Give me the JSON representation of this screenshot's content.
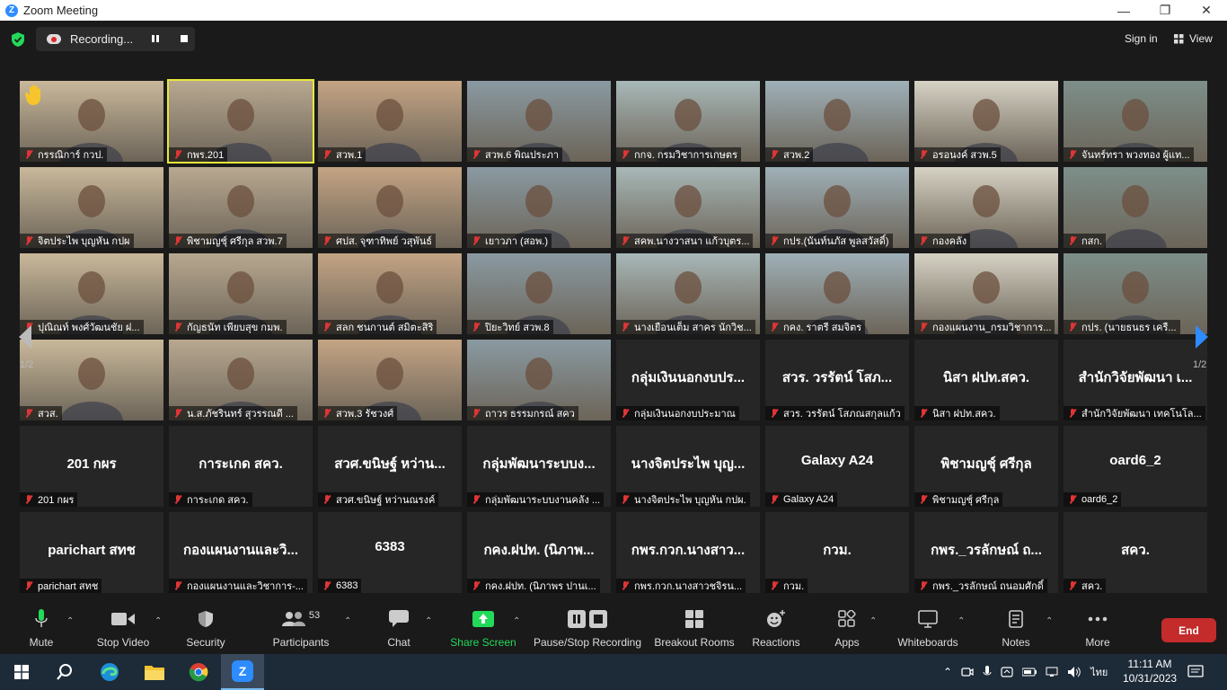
{
  "window": {
    "title": "Zoom Meeting",
    "logo": "Z"
  },
  "topbar": {
    "recording_label": "Recording...",
    "sign_in": "Sign in",
    "view": "View"
  },
  "grid": {
    "page_left": "1/2",
    "page_right": "1/2",
    "tiles": [
      {
        "label": "กรรณิการ์ กวป.",
        "bigname": "",
        "video": true,
        "hand": true
      },
      {
        "label": "กพร.201",
        "bigname": "",
        "video": true,
        "active": true
      },
      {
        "label": "สวพ.1",
        "bigname": "",
        "video": true
      },
      {
        "label": "สวพ.6 พิณประภา",
        "bigname": "",
        "video": true
      },
      {
        "label": "กกจ. กรมวิชาการเกษตร",
        "bigname": "",
        "video": true
      },
      {
        "label": "สวพ.2",
        "bigname": "",
        "video": true
      },
      {
        "label": "อรอนงค์ สวพ.5",
        "bigname": "",
        "video": true
      },
      {
        "label": "จันทร์ทรา พวงทอง ผู้แท...",
        "bigname": "",
        "video": true
      },
      {
        "label": "จิตประไพ บุญหัน กปผ",
        "bigname": "",
        "video": true
      },
      {
        "label": "พิชามญชุ์ ศรีกุล สวพ.7",
        "bigname": "",
        "video": true
      },
      {
        "label": "ศปส. จุฑาทิพย์ วสุพันธ์",
        "bigname": "",
        "video": true
      },
      {
        "label": "เยาวภา (สอพ.)",
        "bigname": "",
        "video": true
      },
      {
        "label": "สคพ.นางวาสนา แก้วบุตร...",
        "bigname": "",
        "video": true
      },
      {
        "label": "กปร.(นันท์นภัส พูลสวัสดิ์)",
        "bigname": "",
        "video": true
      },
      {
        "label": "กองคลัง",
        "bigname": "",
        "video": true
      },
      {
        "label": "กสก.",
        "bigname": "",
        "video": true
      },
      {
        "label": "ปุณิณท์ พงศ์วัฒนชัย ฝ...",
        "bigname": "",
        "video": true
      },
      {
        "label": "กัญธนัท เพียบสุข กมพ.",
        "bigname": "",
        "video": true
      },
      {
        "label": "สลก ชนกานต์ สมิตะสิริ",
        "bigname": "",
        "video": true
      },
      {
        "label": "ปิยะวิทย์ สวพ.8",
        "bigname": "",
        "video": true
      },
      {
        "label": "นางเยือนเต็ม สาคร นักวิช...",
        "bigname": "",
        "video": true
      },
      {
        "label": "กคง. ราตรี สมจิตร",
        "bigname": "",
        "video": true
      },
      {
        "label": "กองแผนงาน_กรมวิชาการ...",
        "bigname": "",
        "video": true
      },
      {
        "label": "กปร. (นายธนธร เครื...",
        "bigname": "",
        "video": true
      },
      {
        "label": "สวส.",
        "bigname": "",
        "video": true
      },
      {
        "label": "น.ส.ภัชรินทร์ สุวรรณดี ...",
        "bigname": "",
        "video": true
      },
      {
        "label": "สวพ.3 รัชวงศ์",
        "bigname": "",
        "video": true
      },
      {
        "label": "ถาวร ธรรมกรณ์ สคว",
        "bigname": "",
        "video": true
      },
      {
        "label": "กลุ่มเงินนอกงบประมาณ",
        "bigname": "กลุ่มเงินนอกงบปร...",
        "video": false
      },
      {
        "label": "สวร. วรรัตน์ โสภณสกุลแก้ว",
        "bigname": "สวร. วรรัตน์ โสภ...",
        "video": false
      },
      {
        "label": "นิสา ฝปท.สคว.",
        "bigname": "นิสา ฝปท.สคว.",
        "video": false
      },
      {
        "label": "สำนักวิจัยพัฒนา เทคโนโล...",
        "bigname": "สำนักวิจัยพัฒนา เ...",
        "video": false
      },
      {
        "label": "201 กผร",
        "bigname": "201 กผร",
        "video": false
      },
      {
        "label": "การะเกด สคว.",
        "bigname": "การะเกด สคว.",
        "video": false
      },
      {
        "label": "สวศ.ขนิษฐ์ หว่านณรงค์",
        "bigname": "สวศ.ขนิษฐ์ หว่าน...",
        "video": false
      },
      {
        "label": "กลุ่มพัฒนาระบบงานคลัง ...",
        "bigname": "กลุ่มพัฒนาระบบง...",
        "video": false
      },
      {
        "label": "นางจิตประไพ บุญหัน กปผ.",
        "bigname": "นางจิตประไพ บุญ...",
        "video": false
      },
      {
        "label": "Galaxy A24",
        "bigname": "Galaxy A24",
        "video": false
      },
      {
        "label": "พิชามญชุ์ ศรีกุล",
        "bigname": "พิชามญชุ์ ศรีกุล",
        "video": false
      },
      {
        "label": "oard6_2",
        "bigname": "oard6_2",
        "video": false
      },
      {
        "label": "parichart สทช",
        "bigname": "parichart สทช",
        "video": false
      },
      {
        "label": "กองแผนงานและวิชาการ-...",
        "bigname": "กองแผนงานและวิ...",
        "video": false
      },
      {
        "label": "6383",
        "bigname": "6383",
        "video": false
      },
      {
        "label": "กคง.ฝปท. (นิภาพร ปานเ...",
        "bigname": "กคง.ฝปท. (นิภาพ...",
        "video": false
      },
      {
        "label": "กพร.กวก.นางสาวชจิรน...",
        "bigname": "กพร.กวก.นางสาว...",
        "video": false
      },
      {
        "label": "กวม.",
        "bigname": "กวม.",
        "video": false
      },
      {
        "label": "กพร._วรลักษณ์ ถนอมศักดิ์",
        "bigname": "กพร._วรลักษณ์ ถ...",
        "video": false
      },
      {
        "label": "สคว.",
        "bigname": "สคว.",
        "video": false
      }
    ]
  },
  "toolbar": {
    "mute": "Mute",
    "stop_video": "Stop Video",
    "security": "Security",
    "participants": "Participants",
    "participants_count": "53",
    "chat": "Chat",
    "share_screen": "Share Screen",
    "pause_recording": "Pause/Stop Recording",
    "breakout": "Breakout Rooms",
    "reactions": "Reactions",
    "apps": "Apps",
    "whiteboards": "Whiteboards",
    "notes": "Notes",
    "more": "More",
    "end": "End"
  },
  "taskbar": {
    "language": "ไทย",
    "time": "11:11 AM",
    "date": "10/31/2023"
  },
  "colors": {
    "share_green": "#23d959",
    "end_red": "#c42b2b",
    "active_speaker": "#e6e83a",
    "accent_blue": "#2d8cff"
  }
}
